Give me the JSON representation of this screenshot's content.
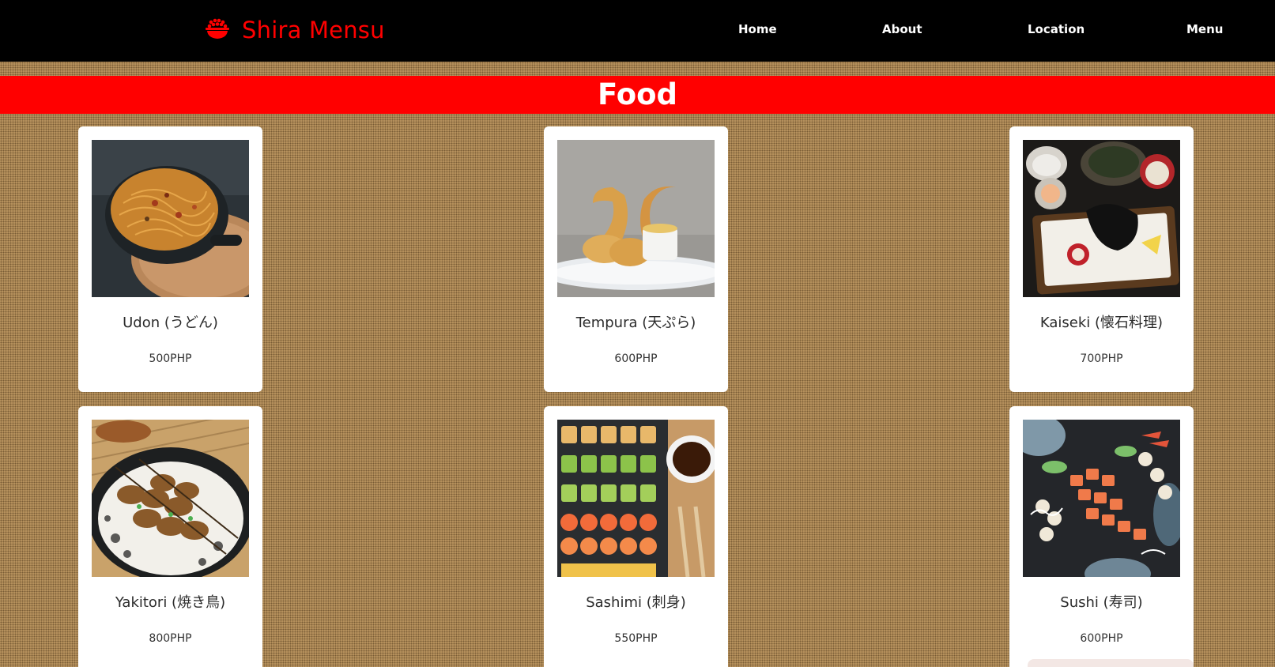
{
  "brand": {
    "name": "Shira Mensu",
    "icon": "sushi-bowl-icon",
    "color": "#ff0000"
  },
  "nav": {
    "links": [
      {
        "label": "Home"
      },
      {
        "label": "About"
      },
      {
        "label": "Location"
      },
      {
        "label": "Menu"
      }
    ]
  },
  "section": {
    "title": "Food",
    "band_color": "#ff0000"
  },
  "menu": {
    "items": [
      {
        "name": "Udon (うどん)",
        "price": "500PHP",
        "image": "udon-photo"
      },
      {
        "name": "Tempura (天ぷら)",
        "price": "600PHP",
        "image": "tempura-photo"
      },
      {
        "name": "Kaiseki (懐石料理)",
        "price": "700PHP",
        "image": "kaiseki-photo"
      },
      {
        "name": "Yakitori (焼き鳥)",
        "price": "800PHP",
        "image": "yakitori-photo"
      },
      {
        "name": "Sashimi (刺身)",
        "price": "550PHP",
        "image": "sashimi-photo"
      },
      {
        "name": "Sushi (寿司)",
        "price": "600PHP",
        "image": "sushi-photo"
      }
    ]
  }
}
